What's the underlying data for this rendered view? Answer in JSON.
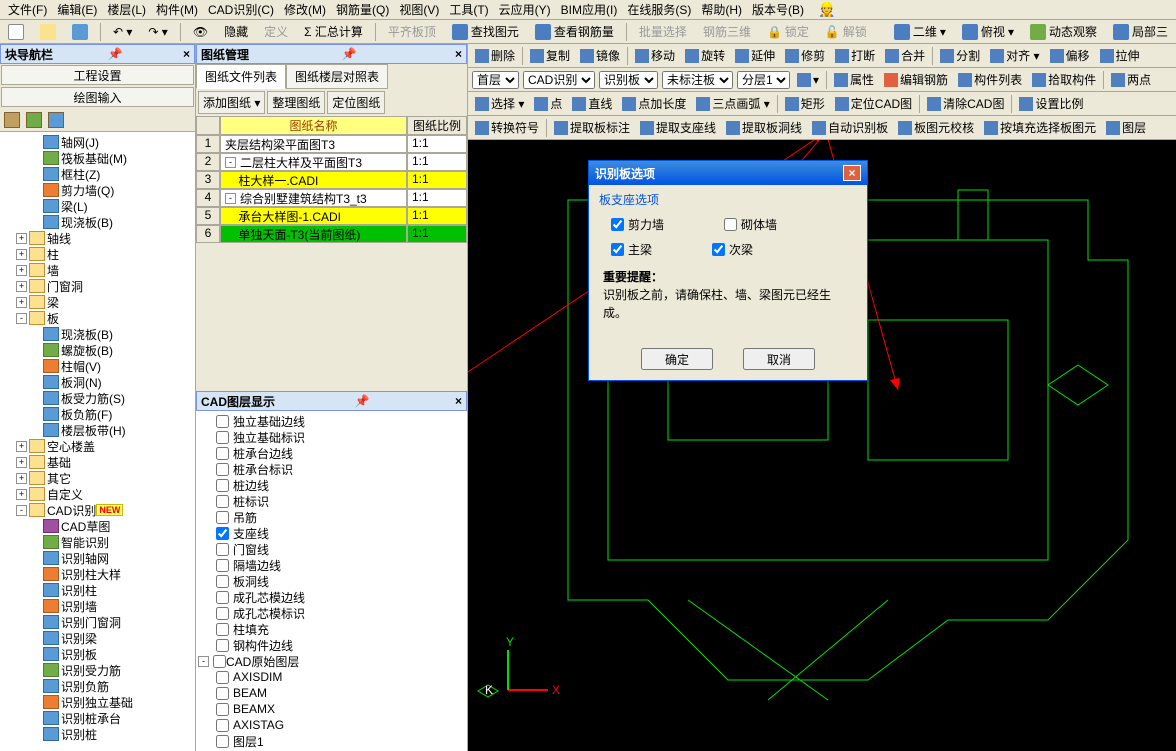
{
  "menubar": [
    "文件(F)",
    "编辑(E)",
    "楼层(L)",
    "构件(M)",
    "CAD识别(C)",
    "修改(M)",
    "钢筋量(Q)",
    "视图(V)",
    "工具(T)",
    "云应用(Y)",
    "BIM应用(I)",
    "在线服务(S)",
    "帮助(H)",
    "版本号(B)"
  ],
  "toolbar1": {
    "hide": "隐藏",
    "define": "定义",
    "summary": "Σ 汇总计算",
    "alignPlate": "平齐板顶",
    "findElem": "查找图元",
    "viewRebar": "查看钢筋量",
    "batchSel": "批量选择",
    "rebar3d": "钢筋三维",
    "lock": "锁定",
    "unlock": "解锁",
    "view2d": "二维",
    "overlook": "俯视",
    "dynObs": "动态观察",
    "partial": "局部三"
  },
  "leftPanel": {
    "title": "块导航栏",
    "row1": "工程设置",
    "row2": "绘图输入",
    "tree": [
      {
        "t": "轴网(J)",
        "i": "leaf-b",
        "d": 2
      },
      {
        "t": "筏板基础(M)",
        "i": "leaf-g",
        "d": 2
      },
      {
        "t": "框柱(Z)",
        "i": "leaf-b",
        "d": 2
      },
      {
        "t": "剪力墙(Q)",
        "i": "leaf-o",
        "d": 2
      },
      {
        "t": "梁(L)",
        "i": "leaf-b",
        "d": 2
      },
      {
        "t": "现浇板(B)",
        "i": "leaf-b",
        "d": 2
      },
      {
        "t": "轴线",
        "i": "folder",
        "d": 1,
        "exp": "+"
      },
      {
        "t": "柱",
        "i": "folder",
        "d": 1,
        "exp": "+"
      },
      {
        "t": "墙",
        "i": "folder",
        "d": 1,
        "exp": "+"
      },
      {
        "t": "门窗洞",
        "i": "folder",
        "d": 1,
        "exp": "+"
      },
      {
        "t": "梁",
        "i": "folder",
        "d": 1,
        "exp": "+"
      },
      {
        "t": "板",
        "i": "folder",
        "d": 1,
        "exp": "-"
      },
      {
        "t": "现浇板(B)",
        "i": "leaf-b",
        "d": 2
      },
      {
        "t": "螺旋板(B)",
        "i": "leaf-g",
        "d": 2
      },
      {
        "t": "柱帽(V)",
        "i": "leaf-o",
        "d": 2
      },
      {
        "t": "板洞(N)",
        "i": "leaf-b",
        "d": 2
      },
      {
        "t": "板受力筋(S)",
        "i": "leaf-b",
        "d": 2
      },
      {
        "t": "板负筋(F)",
        "i": "leaf-b",
        "d": 2
      },
      {
        "t": "楼层板带(H)",
        "i": "leaf-b",
        "d": 2
      },
      {
        "t": "空心楼盖",
        "i": "folder",
        "d": 1,
        "exp": "+"
      },
      {
        "t": "基础",
        "i": "folder",
        "d": 1,
        "exp": "+"
      },
      {
        "t": "其它",
        "i": "folder",
        "d": 1,
        "exp": "+"
      },
      {
        "t": "自定义",
        "i": "folder",
        "d": 1,
        "exp": "+"
      },
      {
        "t": "CAD识别",
        "i": "folder",
        "d": 1,
        "exp": "-",
        "badge": "NEW"
      },
      {
        "t": "CAD草图",
        "i": "leaf-p",
        "d": 2
      },
      {
        "t": "智能识别",
        "i": "leaf-g",
        "d": 2
      },
      {
        "t": "识别轴网",
        "i": "leaf-b",
        "d": 2
      },
      {
        "t": "识别柱大样",
        "i": "leaf-o",
        "d": 2
      },
      {
        "t": "识别柱",
        "i": "leaf-b",
        "d": 2
      },
      {
        "t": "识别墙",
        "i": "leaf-o",
        "d": 2
      },
      {
        "t": "识别门窗洞",
        "i": "leaf-b",
        "d": 2
      },
      {
        "t": "识别梁",
        "i": "leaf-b",
        "d": 2
      },
      {
        "t": "识别板",
        "i": "leaf-b",
        "d": 2
      },
      {
        "t": "识别受力筋",
        "i": "leaf-g",
        "d": 2
      },
      {
        "t": "识别负筋",
        "i": "leaf-b",
        "d": 2
      },
      {
        "t": "识别独立基础",
        "i": "leaf-o",
        "d": 2
      },
      {
        "t": "识别桩承台",
        "i": "leaf-b",
        "d": 2
      },
      {
        "t": "识别桩",
        "i": "leaf-b",
        "d": 2
      }
    ]
  },
  "midPanel": {
    "title": "图纸管理",
    "tabs": [
      "图纸文件列表",
      "图纸楼层对照表"
    ],
    "toolbarBtns": [
      "添加图纸 ▾",
      "整理图纸",
      "定位图纸"
    ],
    "headers": {
      "name": "图纸名称",
      "scale": "图纸比例"
    },
    "rows": [
      {
        "n": "1",
        "name": "夹层结构梁平面图T3",
        "scale": "1:1",
        "cls": ""
      },
      {
        "n": "2",
        "name": "二层柱大样及平面图T3",
        "scale": "1:1",
        "cls": "",
        "exp": "-"
      },
      {
        "n": "3",
        "name": "柱大样一.CADI",
        "scale": "1:1",
        "cls": "yellow",
        "indent": true
      },
      {
        "n": "4",
        "name": "综合别墅建筑结构T3_t3",
        "scale": "1:1",
        "cls": "",
        "exp": "-"
      },
      {
        "n": "5",
        "name": "承台大样图-1.CADI",
        "scale": "1:1",
        "cls": "yellow",
        "indent": true
      },
      {
        "n": "6",
        "name": "单独天面-T3(当前图纸)",
        "scale": "1:1",
        "cls": "green",
        "indent": true
      }
    ],
    "cadLayerTitle": "CAD图层显示",
    "layers": [
      {
        "t": "独立基础边线",
        "c": false
      },
      {
        "t": "独立基础标识",
        "c": false
      },
      {
        "t": "桩承台边线",
        "c": false
      },
      {
        "t": "桩承台标识",
        "c": false
      },
      {
        "t": "桩边线",
        "c": false
      },
      {
        "t": "桩标识",
        "c": false
      },
      {
        "t": "吊筋",
        "c": false
      },
      {
        "t": "支座线",
        "c": true
      },
      {
        "t": "门窗线",
        "c": false
      },
      {
        "t": "隔墙边线",
        "c": false
      },
      {
        "t": "板洞线",
        "c": false
      },
      {
        "t": "成孔芯模边线",
        "c": false
      },
      {
        "t": "成孔芯模标识",
        "c": false
      },
      {
        "t": "柱填充",
        "c": false
      },
      {
        "t": "钢构件边线",
        "c": false
      }
    ],
    "layerGroup": "CAD原始图层",
    "origLayers": [
      "AXISDIM",
      "BEAM",
      "BEAMX",
      "AXISTAG",
      "图层1"
    ]
  },
  "canvasToolbars": {
    "r1": [
      "删除",
      "复制",
      "镜像",
      "移动",
      "旋转",
      "延伸",
      "修剪",
      "打断",
      "合并",
      "分割",
      "对齐 ▾",
      "偏移",
      "拉伸"
    ],
    "r2": {
      "floor": "首层",
      "cadRec": "CAD识别",
      "recPlate": "识别板",
      "unMarked": "未标注板",
      "layer": "分层1",
      "attr": "属性",
      "editRebar": "编辑钢筋",
      "compList": "构件列表",
      "pickComp": "拾取构件",
      "twoPt": "两点"
    },
    "r3": [
      "选择 ▾",
      "点",
      "直线",
      "点加长度",
      "三点画弧 ▾",
      "矩形",
      "定位CAD图",
      "清除CAD图",
      "设置比例"
    ],
    "r4": [
      "转换符号",
      "提取板标注",
      "提取支座线",
      "提取板洞线",
      "自动识别板",
      "板图元校核",
      "按填充选择板图元",
      "图层"
    ]
  },
  "dialog": {
    "title": "识别板选项",
    "section": "板支座选项",
    "cb1": "剪力墙",
    "cb2": "砌体墙",
    "cb3": "主梁",
    "cb4": "次梁",
    "noteTitle": "重要提醒：",
    "noteBody": "识别板之前，请确保柱、墙、梁图元已经生成。",
    "ok": "确定",
    "cancel": "取消"
  }
}
